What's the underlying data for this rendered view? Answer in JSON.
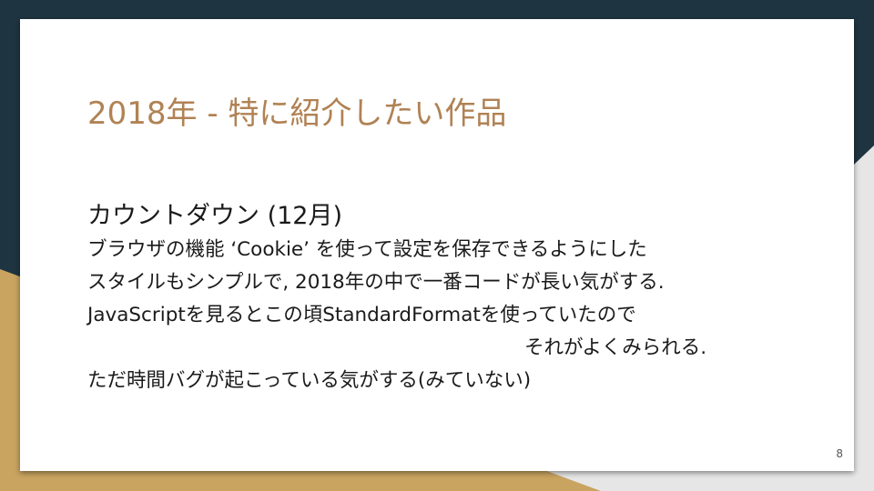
{
  "slide": {
    "title": "2018年 - 特に紹介したい作品",
    "subheading": "カウントダウン (12月)",
    "lines": [
      "ブラウザの機能 ‘Cookie’ を使って設定を保存できるようにした",
      "スタイルもシンプルで, 2018年の中で一番コードが長い気がする.",
      "JavaScriptを見るとこの頃StandardFormatを使っていたので",
      "それがよくみられる.",
      "ただ時間バグが起こっている気がする(みていない)"
    ],
    "page_number": "8"
  },
  "colors": {
    "navy": "#1f3441",
    "gold": "#c9a460",
    "light_gray": "#e6e6e6",
    "title_color": "#b08254",
    "text_color": "#1a1a1a"
  }
}
